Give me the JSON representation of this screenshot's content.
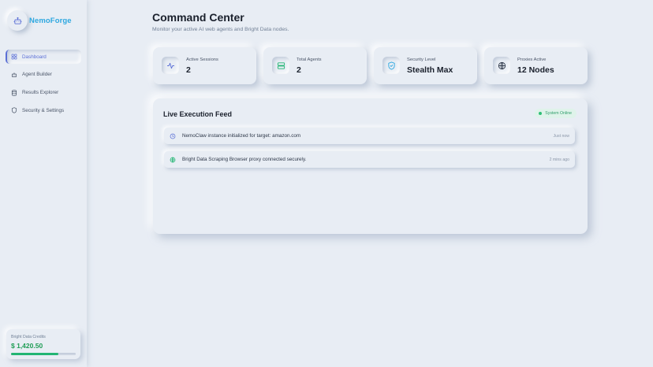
{
  "brand": {
    "name": "NemoForge",
    "logo_icon": "robot-icon"
  },
  "sidebar": {
    "items": [
      {
        "label": "Dashboard",
        "icon": "dashboard-icon",
        "active": true
      },
      {
        "label": "Agent Builder",
        "icon": "robot-icon",
        "active": false
      },
      {
        "label": "Results Explorer",
        "icon": "database-icon",
        "active": false
      },
      {
        "label": "Security & Settings",
        "icon": "shield-icon",
        "active": false
      }
    ],
    "credits": {
      "label": "Bright Data Credits",
      "value": "$ 1,420.50",
      "progress_fraction": 0.73
    }
  },
  "header": {
    "title": "Command Center",
    "subtitle": "Monitor your active AI web agents and Bright Data nodes."
  },
  "stats": [
    {
      "label": "Active Sessions",
      "value": "2",
      "icon": "activity-icon",
      "color": "#5b6fd6"
    },
    {
      "label": "Total Agents",
      "value": "2",
      "icon": "server-icon",
      "color": "#22b573"
    },
    {
      "label": "Security Level",
      "value": "Stealth Max",
      "icon": "shield-check-icon",
      "color": "#2ea8e0"
    },
    {
      "label": "Proxies Active",
      "value": "12 Nodes",
      "icon": "globe-icon",
      "color": "#2d3748"
    }
  ],
  "feed": {
    "title": "Live Execution Feed",
    "status": "System Online",
    "events": [
      {
        "message": "NemoClaw instance initialized for target: amazon.com",
        "time": "Just now",
        "icon": "clock-icon"
      },
      {
        "message": "Bright Data Scraping Browser proxy connected securely.",
        "time": "2 mins ago",
        "icon": "globe-icon"
      }
    ]
  },
  "colors": {
    "background": "#e8edf4",
    "accent": "#5b6fd6",
    "brand": "#2ea8e0",
    "success": "#22b573"
  }
}
